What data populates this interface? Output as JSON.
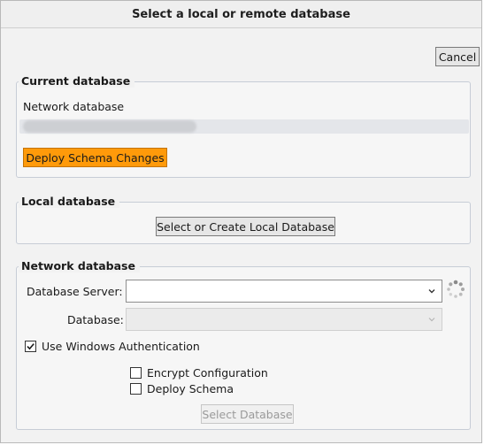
{
  "dialog": {
    "title": "Select a local or remote database",
    "cancel_label": "Cancel"
  },
  "current_database": {
    "group_label": "Current database",
    "connection_label": "Network database",
    "deploy_label": "Deploy Schema Changes"
  },
  "local_database": {
    "group_label": "Local database",
    "select_create_label": "Select or Create Local Database"
  },
  "network_database": {
    "group_label": "Network database",
    "server_label": "Database Server:",
    "server_value": "",
    "database_label": "Database:",
    "database_value": "",
    "windows_auth_label": "Use Windows Authentication",
    "windows_auth_checked": true,
    "encrypt_label": "Encrypt Configuration",
    "encrypt_checked": false,
    "deploy_schema_label": "Deploy Schema",
    "deploy_schema_checked": false,
    "select_database_label": "Select Database"
  },
  "colors": {
    "accent_orange": "#ff9a0a",
    "dialog_background": "#f2f2f2",
    "group_border": "#c7cdd6"
  },
  "icons": {
    "server_dropdown": "chevron-down-icon",
    "database_dropdown": "chevron-down-icon",
    "loading": "spinner-icon",
    "check": "check-icon"
  }
}
